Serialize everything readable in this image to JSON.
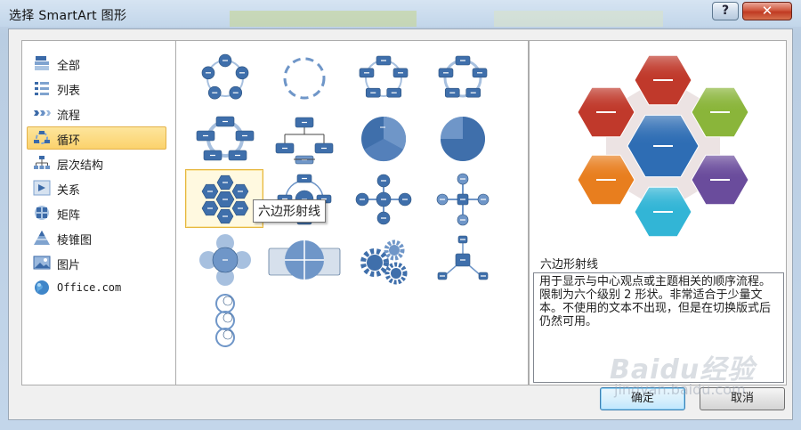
{
  "window": {
    "title": "选择 SmartArt 图形",
    "help_label": "?",
    "close_label": "✕"
  },
  "categories": [
    {
      "label": "全部",
      "icon": "all-icon"
    },
    {
      "label": "列表",
      "icon": "list-icon"
    },
    {
      "label": "流程",
      "icon": "process-icon"
    },
    {
      "label": "循环",
      "icon": "cycle-icon",
      "selected": true
    },
    {
      "label": "层次结构",
      "icon": "hierarchy-icon"
    },
    {
      "label": "关系",
      "icon": "relationship-icon"
    },
    {
      "label": "矩阵",
      "icon": "matrix-icon"
    },
    {
      "label": "棱锥图",
      "icon": "pyramid-icon"
    },
    {
      "label": "图片",
      "icon": "picture-icon"
    },
    {
      "label": "Office.com",
      "icon": "office-globe-icon"
    }
  ],
  "gallery": {
    "selected_index": 8,
    "tooltip": "六边形射线",
    "layouts": [
      "basic-cycle",
      "text-cycle",
      "block-cycle",
      "nondirectional-cycle",
      "continuous-cycle",
      "segmented-cycle",
      "basic-pie",
      "multidirectional-pie",
      "hexagon-radial",
      "basic-radial",
      "radial-cycle",
      "diverging-radial",
      "radial-venn",
      "cycle-matrix",
      "gear",
      "radial-cluster",
      "circle-arrow-process"
    ]
  },
  "preview": {
    "title": "六边形射线",
    "description": "用于显示与中心观点或主题相关的顺序流程。限制为六个级别 2 形状。非常适合于少量文本。不使用的文本不出现，但是在切换版式后仍然可用。",
    "hex_colors": [
      "#2e6db4",
      "#c0392b",
      "#8ab53a",
      "#6a4c9c",
      "#32b5d6",
      "#e87e1e"
    ]
  },
  "buttons": {
    "ok": "确定",
    "cancel": "取消"
  },
  "watermark": {
    "main": "Baidu经验",
    "sub": "jingyan.baidu.com"
  }
}
